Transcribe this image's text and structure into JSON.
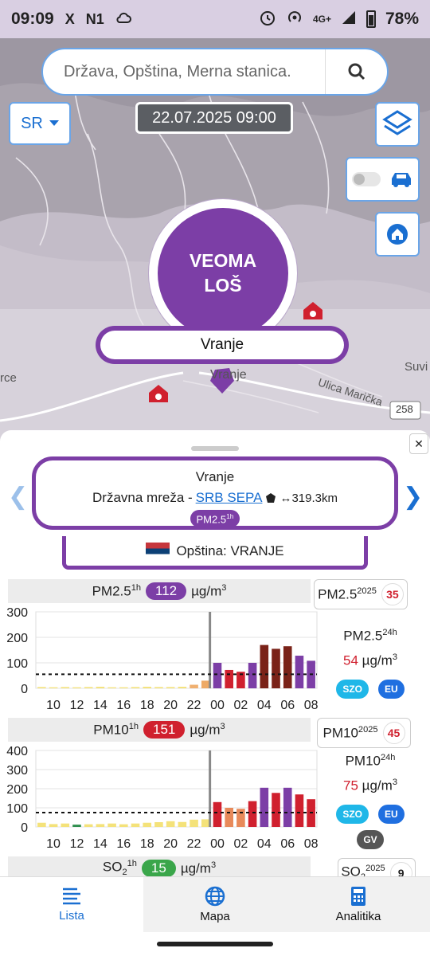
{
  "status_bar": {
    "time": "09:09",
    "glyphs": [
      "X",
      "N1"
    ],
    "network": "4G+",
    "battery": "78%"
  },
  "map": {
    "search_placeholder": "Država, Opština, Merna stanica.",
    "language": "SR",
    "datetime": "22.07.2025 09:00",
    "aqi_status": "VEOMA LOŠ",
    "station_label": "Vranje",
    "place_labels": {
      "left": "rce",
      "right": "Suvi",
      "town": "Vranje",
      "street": "Ulica Marička",
      "road_number": "258"
    }
  },
  "colors": {
    "very_bad": "#7c3ea6",
    "bad": "#d0202e",
    "moderate": "#e3a0a0",
    "accent": "#1a6fd1"
  },
  "station_card": {
    "name": "Vranje",
    "network_prefix": "Državna mreža - ",
    "network_link": "SRB SEPA",
    "distance": "↔319.3km",
    "pollutant_badge": "PM2.5",
    "pollutant_badge_sup": "1h",
    "municipality": "Opština: VRANJE"
  },
  "pm25": {
    "title": "PM2.5",
    "title_sup": "1h",
    "value": "112",
    "unit": "µg/m",
    "unit_sup": "3",
    "year_label": "PM2.5",
    "year_sup": "2025",
    "year_count": "35",
    "avg_label": "PM2.5",
    "avg_sup": "24h",
    "avg_value": "54",
    "avg_unit": "µg/m",
    "avg_unit_sup": "3",
    "chips": [
      "SZO",
      "EU"
    ]
  },
  "pm10": {
    "title": "PM10",
    "title_sup": "1h",
    "value": "151",
    "unit": "µg/m",
    "unit_sup": "3",
    "year_label": "PM10",
    "year_sup": "2025",
    "year_count": "45",
    "avg_label": "PM10",
    "avg_sup": "24h",
    "avg_value": "75",
    "avg_unit": "µg/m",
    "avg_unit_sup": "3",
    "chips": [
      "SZO",
      "EU",
      "GV"
    ]
  },
  "so2": {
    "title": "SO",
    "title_sub": "2",
    "title_sup": "1h",
    "value": "15",
    "unit": "µg/m",
    "unit_sup": "3",
    "year_label": "SO",
    "year_sub": "2",
    "year_sup": "2025",
    "year_count": "9"
  },
  "nav": {
    "list": "Lista",
    "map": "Mapa",
    "analytics": "Analitika"
  },
  "chart_data": [
    {
      "type": "bar",
      "title": "PM2.5 1h",
      "categories": [
        "09",
        "10",
        "11",
        "12",
        "13",
        "14",
        "15",
        "16",
        "17",
        "18",
        "19",
        "20",
        "21",
        "22",
        "23",
        "00",
        "01",
        "02",
        "03",
        "04",
        "05",
        "06",
        "07",
        "08"
      ],
      "x_tick_labels": [
        "10",
        "12",
        "14",
        "16",
        "18",
        "20",
        "22",
        "00",
        "02",
        "04",
        "06",
        "08"
      ],
      "values": [
        5,
        4,
        5,
        4,
        5,
        6,
        4,
        4,
        5,
        6,
        5,
        5,
        6,
        14,
        30,
        100,
        72,
        65,
        100,
        170,
        155,
        165,
        128,
        108
      ],
      "bar_colors": [
        "#f4e27a",
        "#f4e27a",
        "#f4e27a",
        "#f4e27a",
        "#f4e27a",
        "#f4e27a",
        "#f4e27a",
        "#f4e27a",
        "#f4e27a",
        "#f4e27a",
        "#f4e27a",
        "#f4e27a",
        "#f4e27a",
        "#f0b070",
        "#eeaa66",
        "#7c3ea6",
        "#d0202e",
        "#d0202e",
        "#7c3ea6",
        "#7a2218",
        "#7a2218",
        "#7a2218",
        "#7c3ea6",
        "#7c3ea6"
      ],
      "ylim": [
        0,
        300
      ],
      "yticks": [
        0,
        100,
        200,
        300
      ],
      "limit_line": 55,
      "divider_index": 15
    },
    {
      "type": "bar",
      "title": "PM10 1h",
      "categories": [
        "09",
        "10",
        "11",
        "12",
        "13",
        "14",
        "15",
        "16",
        "17",
        "18",
        "19",
        "20",
        "21",
        "22",
        "23",
        "00",
        "01",
        "02",
        "03",
        "04",
        "05",
        "06",
        "07",
        "08"
      ],
      "x_tick_labels": [
        "10",
        "12",
        "14",
        "16",
        "18",
        "20",
        "22",
        "00",
        "02",
        "04",
        "06",
        "08"
      ],
      "values": [
        22,
        15,
        18,
        12,
        14,
        15,
        18,
        14,
        18,
        22,
        25,
        30,
        26,
        38,
        40,
        130,
        100,
        95,
        135,
        205,
        178,
        205,
        170,
        145
      ],
      "bar_colors": [
        "#f4e27a",
        "#f4e27a",
        "#f4e27a",
        "#2f8f4e",
        "#f4e27a",
        "#f4e27a",
        "#f4e27a",
        "#f4e27a",
        "#f4e27a",
        "#f4e27a",
        "#f4e27a",
        "#f4e27a",
        "#f4e27a",
        "#f4e27a",
        "#f4e27a",
        "#d0202e",
        "#e88a5a",
        "#e88a5a",
        "#d0202e",
        "#7c3ea6",
        "#d0202e",
        "#7c3ea6",
        "#d0202e",
        "#d0202e"
      ],
      "ylim": [
        0,
        400
      ],
      "yticks": [
        0,
        100,
        200,
        300,
        400
      ],
      "limit_line": 75,
      "divider_index": 15
    }
  ]
}
